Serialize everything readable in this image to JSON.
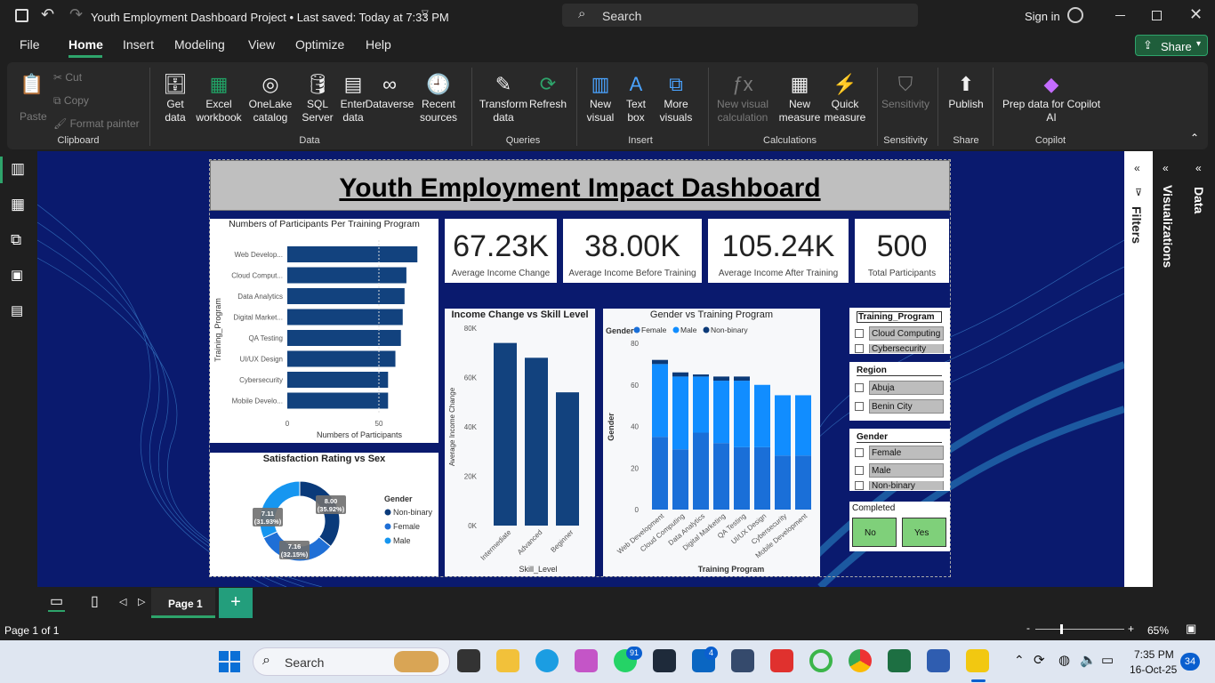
{
  "titlebar": {
    "title": "Youth Employment Dashboard Project • Last saved: Today at 7:33 PM",
    "search": "Search",
    "signin": "Sign in"
  },
  "menu": {
    "file": "File",
    "home": "Home",
    "insert": "Insert",
    "modeling": "Modeling",
    "view": "View",
    "optimize": "Optimize",
    "help": "Help",
    "share": "Share"
  },
  "ribbon": {
    "clipboard": {
      "paste": "Paste",
      "cut": "Cut",
      "copy": "Copy",
      "format_painter": "Format painter",
      "group": "Clipboard"
    },
    "data": {
      "get_data": "Get data",
      "excel": "Excel workbook",
      "onelake": "OneLake catalog",
      "sql": "SQL Server",
      "enter": "Enter data",
      "dataverse": "Dataverse",
      "recent": "Recent sources",
      "group": "Data"
    },
    "queries": {
      "transform": "Transform data",
      "refresh": "Refresh",
      "group": "Queries"
    },
    "insert": {
      "new_visual": "New visual",
      "text_box": "Text box",
      "more_visuals": "More visuals",
      "group": "Insert"
    },
    "calculations": {
      "new_visual_calc": "New visual calculation",
      "new_measure": "New measure",
      "quick_measure": "Quick measure",
      "group": "Calculations"
    },
    "sensitivity": {
      "label": "Sensitivity",
      "group": "Sensitivity"
    },
    "share": {
      "publish": "Publish",
      "group": "Share"
    },
    "copilot": {
      "prep": "Prep data for Copilot AI",
      "group": "Copilot"
    }
  },
  "report": {
    "title": "Youth Employment Impact Dashboard",
    "kpis": [
      {
        "value": "67.23K",
        "label": "Average Income Change"
      },
      {
        "value": "38.00K",
        "label": "Average  Income Before Training"
      },
      {
        "value": "105.24K",
        "label": "Average Income After Training"
      },
      {
        "value": "500",
        "label": "Total Participants"
      }
    ],
    "bar_title": "Numbers of Participants Per Training Program",
    "donut_title": "Satisfaction Rating vs Sex",
    "donut_legend_title": "Gender",
    "income_title": "Income Change vs Skill Level",
    "gender_title": "Gender vs Training Program",
    "gender_legend_title": "Gender"
  },
  "chart_data": [
    {
      "type": "bar",
      "title": "Numbers of Participants Per Training Program",
      "categories": [
        "Web Develop...",
        "Cloud Comput...",
        "Data Analytics",
        "Digital Market...",
        "QA Testing",
        "UI/UX Design",
        "Cybersecurity",
        "Mobile Develo..."
      ],
      "values": [
        71,
        65,
        64,
        63,
        62,
        59,
        55,
        55
      ],
      "xlabel": "Numbers of Participants",
      "ylabel": "Training_Program",
      "xticks": [
        "0",
        "50"
      ],
      "color": "#12427e"
    },
    {
      "type": "pie",
      "title": "Satisfaction Rating vs Sex",
      "legend": [
        "Non-binary",
        "Female",
        "Male"
      ],
      "slices": [
        {
          "name": "Non-binary",
          "value": 8.0,
          "label": "8.00\n(35.92%)",
          "pct": 35.92,
          "color": "#0a3a7a"
        },
        {
          "name": "Female",
          "value": 7.16,
          "label": "7.16\n(32.15%)",
          "pct": 32.15,
          "color": "#1f6fd6"
        },
        {
          "name": "Male",
          "value": 7.11,
          "label": "7.11\n(31.93%)",
          "pct": 31.93,
          "color": "#1696f0"
        }
      ]
    },
    {
      "type": "bar",
      "title": "Income Change vs Skill Level",
      "categories": [
        "Intermediate",
        "Advanced",
        "Beginner"
      ],
      "values": [
        74000,
        68000,
        54000
      ],
      "xlabel": "Skill_Level",
      "ylabel": "Average Income Change",
      "yticks": [
        "0K",
        "20K",
        "40K",
        "60K",
        "80K"
      ],
      "ylim": [
        0,
        80000
      ],
      "color": "#12427e"
    },
    {
      "type": "bar",
      "title": "Gender vs Training Program",
      "categories": [
        "Web Development",
        "Cloud Computing",
        "Data Analytics",
        "Digital Marketing",
        "QA Testing",
        "UI/UX Design",
        "Cybersecurity",
        "Mobile Development"
      ],
      "series": [
        {
          "name": "Female",
          "values": [
            35,
            29,
            37,
            32,
            30,
            30,
            26,
            26
          ],
          "color": "#1a6fd8"
        },
        {
          "name": "Male",
          "values": [
            35,
            35,
            27,
            30,
            32,
            30,
            29,
            29
          ],
          "color": "#118dff"
        },
        {
          "name": "Non-binary",
          "values": [
            2,
            2,
            1,
            2,
            2,
            0,
            0,
            0
          ],
          "color": "#0c3a78"
        }
      ],
      "xlabel": "Training Program",
      "ylabel": "Gender",
      "yticks": [
        "0",
        "20",
        "40",
        "60",
        "80"
      ],
      "ylim": [
        0,
        80
      ]
    }
  ],
  "slicers": {
    "training": {
      "title": "Training_Program",
      "items": [
        "Cloud Computing",
        "Cybersecurity"
      ]
    },
    "region": {
      "title": "Region",
      "items": [
        "Abuja",
        "Benin City"
      ]
    },
    "gender": {
      "title": "Gender",
      "items": [
        "Female",
        "Male",
        "Non-binary"
      ]
    },
    "completed": {
      "title": "Completed",
      "no": "No",
      "yes": "Yes"
    }
  },
  "panes": {
    "filters": "Filters",
    "visualizations": "Visualizations",
    "data": "Data"
  },
  "pages": {
    "page1": "Page 1",
    "add": "+"
  },
  "status": {
    "page": "Page 1 of 1",
    "zoom": "65%",
    "minus": "-",
    "plus": "+"
  },
  "taskbar": {
    "search": "Search",
    "time": "7:35 PM",
    "date": "16-Oct-25",
    "whatsapp_badge": "91",
    "linkedin_badge": "4",
    "notif": "34"
  }
}
